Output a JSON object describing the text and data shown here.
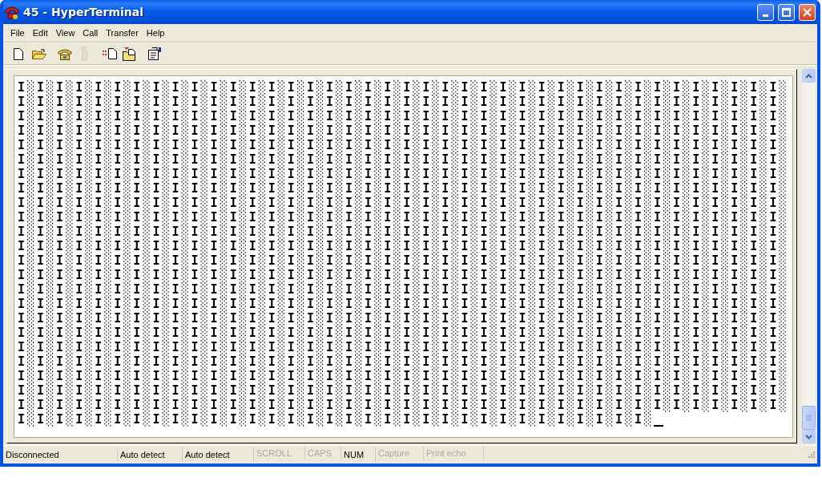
{
  "window": {
    "title": "45 - HyperTerminal"
  },
  "menu": [
    "File",
    "Edit",
    "View",
    "Call",
    "Transfer",
    "Help"
  ],
  "toolbar": [
    {
      "kind": "new",
      "disabled": false
    },
    {
      "kind": "open",
      "disabled": false
    },
    {
      "kind": "call",
      "disabled": false
    },
    {
      "kind": "hangup",
      "disabled": true
    },
    {
      "kind": "send",
      "disabled": false
    },
    {
      "kind": "receive",
      "disabled": false
    },
    {
      "kind": "properties",
      "disabled": false
    }
  ],
  "terminal": {
    "lines": [
      "I░I░I░I░I░I░I░I░I░I░I░I░I░I░I░I░I░I░I░I░I░I░I░I░I░I░I░I░I░I░I░I░I░I░I░I░I░I░I░I░",
      "I░I░I░I░I░I░I░I░I░I░I░I░I░I░I░I░I░I░I░I░I░I░I░I░I░I░I░I░I░I░I░I░I░I░I░I░I░I░I░I░",
      "I░I░I░I░I░I░I░I░I░I░I░I░I░I░I░I░I░I░I░I░I░I░I░I░I░I░I░I░I░I░I░I░I░I░I░I░I░I░I░I░",
      "I░I░I░I░I░I░I░I░I░I░I░I░I░I░I░I░I░I░I░I░I░I░I░I░I░I░I░I░I░I░I░I░I░I░I░I░I░I░I░I░",
      "I░I░I░I░I░I░I░I░I░I░I░I░I░I░I░I░I░I░I░I░I░I░I░I░I░I░I░I░I░I░I░I░I░I░I░I░I░I░I░I░",
      "I░I░I░I░I░I░I░I░I░I░I░I░I░I░I░I░I░I░I░I░I░I░I░I░I░I░I░I░I░I░I░I░I░I░I░I░I░I░I░I░",
      "I░I░I░I░I░I░I░I░I░I░I░I░I░I░I░I░I░I░I░I░I░I░I░I░I░I░I░I░I░I░I░I░I░I░I░I░I░I░I░I░",
      "I░I░I░I░I░I░I░I░I░I░I░I░I░I░I░I░I░I░I░I░I░I░I░I░I░I░I░I░I░I░I░I░I░I░I░I░I░I░I░I░",
      "I░I░I░I░I░I░I░I░I░I░I░I░I░I░I░I░I░I░I░I░I░I░I░I░I░I░I░I░I░I░I░I░I░I░I░I░I░I░I░I░",
      "I░I░I░I░I░I░I░I░I░I░I░I░I░I░I░I░I░I░I░I░I░I░I░I░I░I░I░I░I░I░I░I░I░I░I░I░I░I░I░I░",
      "I░I░I░I░I░I░I░I░I░I░I░I░I░I░I░I░I░I░I░I░I░I░I░I░I░I░I░I░I░I░I░I░I░I░I░I░I░I░I░I░",
      "I░I░I░I░I░I░I░I░I░I░I░I░I░I░I░I░I░I░I░I░I░I░I░I░I░I░I░I░I░I░I░I░I░I░I░I░I░I░I░I░",
      "I░I░I░I░I░I░I░I░I░I░I░I░I░I░I░I░I░I░I░I░I░I░I░I░I░I░I░I░I░I░I░I░I░I░I░I░I░I░I░I░",
      "I░I░I░I░I░I░I░I░I░I░I░I░I░I░I░I░I░I░I░I░I░I░I░I░I░I░I░I░I░I░I░I░I░I░I░I░I░I░I░I░",
      "I░I░I░I░I░I░I░I░I░I░I░I░I░I░I░I░I░I░I░I░I░I░I░I░I░I░I░I░I░I░I░I░I░I░I░I░I░I░I░I░",
      "I░I░I░I░I░I░I░I░I░I░I░I░I░I░I░I░I░I░I░I░I░I░I░I░I░I░I░I░I░I░I░I░I░I░I░I░I░I░I░I░",
      "I░I░I░I░I░I░I░I░I░I░I░I░I░I░I░I░I░I░I░I░I░I░I░I░I░I░I░I░I░I░I░I░I░I░I░I░I░I░I░I░",
      "I░I░I░I░I░I░I░I░I░I░I░I░I░I░I░I░I░I░I░I░I░I░I░I░I░I░I░I░I░I░I░I░I░I░I░I░I░I░I░I░",
      "I░I░I░I░I░I░I░I░I░I░I░I░I░I░I░I░I░I░I░I░I░I░I░I░I░I░I░I░I░I░I░I░I░I░I░I░I░I░I░I░",
      "I░I░I░I░I░I░I░I░I░I░I░I░I░I░I░I░I░I░I░I░I░I░I░I░I░I░I░I░I░I░I░I░I░I░I░I░I░I░I░I░",
      "I░I░I░I░I░I░I░I░I░I░I░I░I░I░I░I░I░I░I░I░I░I░I░I░I░I░I░I░I░I░I░I░I░I░I░I░I░I░I░I░",
      "I░I░I░I░I░I░I░I░I░I░I░I░I░I░I░I░I░I░I░I░I░I░I░I░I░I░I░I░I░I░I░I░I░I░I░I░I░I░I░I░",
      "I░I░I░I░I░I░I░I░I░I░I░I░I░I░I░I░I░I░I░I░I░I░I░I░I░I░I░I░I░I░I░I░I░I░I░I░I░I░I░I░",
      "I░I░I░I░I░I░I░I░I░I░I░I░I░I░I░I░I░I░I░I░I░I░I░I░I░I░I░I░I░I░I░I░I░"
    ]
  },
  "status_bar": [
    {
      "text": "Disconnected",
      "disabled": false
    },
    {
      "text": "Auto detect",
      "disabled": false
    },
    {
      "text": "Auto detect",
      "disabled": false
    },
    {
      "text": "SCROLL",
      "disabled": true
    },
    {
      "text": "CAPS",
      "disabled": true
    },
    {
      "text": "NUM",
      "disabled": false
    },
    {
      "text": "Capture",
      "disabled": true
    },
    {
      "text": "Print echo",
      "disabled": true
    }
  ]
}
